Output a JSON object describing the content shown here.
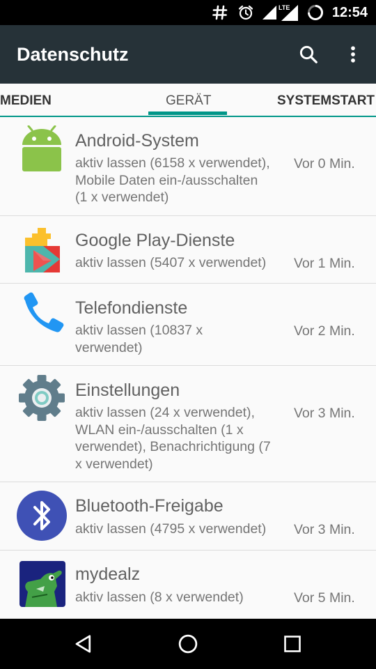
{
  "status_bar": {
    "time": "12:54",
    "icons": [
      "hash-icon",
      "alarm-icon",
      "signal-icon",
      "lte-signal-icon",
      "loading-icon"
    ],
    "lte_label": "LTE"
  },
  "app_bar": {
    "title": "Datenschutz",
    "actions": [
      "search-icon",
      "more-vert-icon"
    ]
  },
  "tabs": [
    {
      "label": "MEDIEN",
      "active": false
    },
    {
      "label": "GERÄT",
      "active": true
    },
    {
      "label": "SYSTEMSTART",
      "active": false
    }
  ],
  "colors": {
    "accent": "#009688",
    "app_bar": "#263238"
  },
  "apps": [
    {
      "name": "Android-System",
      "icon": "android-icon",
      "time": "Vor 0 Min.",
      "lines": [
        "aktiv lassen (6158 x verwendet),",
        "Mobile Daten ein-/ausschalten",
        "(1 x verwendet)"
      ]
    },
    {
      "name": "Google Play-Dienste",
      "icon": "google-play-services-icon",
      "time": "Vor 1 Min.",
      "lines": [
        "aktiv lassen (5407 x verwendet)"
      ]
    },
    {
      "name": "Telefondienste",
      "icon": "phone-icon",
      "time": "Vor 2 Min.",
      "lines": [
        "aktiv lassen (10837 x",
        "verwendet)"
      ]
    },
    {
      "name": "Einstellungen",
      "icon": "settings-gear-icon",
      "time": "Vor 3 Min.",
      "lines": [
        "aktiv lassen (24 x verwendet),",
        "WLAN ein-/ausschalten (1 x",
        "verwendet), Benachrichtigung (7",
        "x verwendet)"
      ]
    },
    {
      "name": "Bluetooth-Freigabe",
      "icon": "bluetooth-icon",
      "time": "Vor 3 Min.",
      "lines": [
        "aktiv lassen (4795 x verwendet)"
      ]
    },
    {
      "name": "mydealz",
      "icon": "mydealz-icon",
      "time": "Vor 5 Min.",
      "lines": [
        "aktiv lassen (8 x verwendet)"
      ]
    }
  ],
  "nav_bar": {
    "buttons": [
      "back-icon",
      "home-icon",
      "recents-icon"
    ]
  }
}
